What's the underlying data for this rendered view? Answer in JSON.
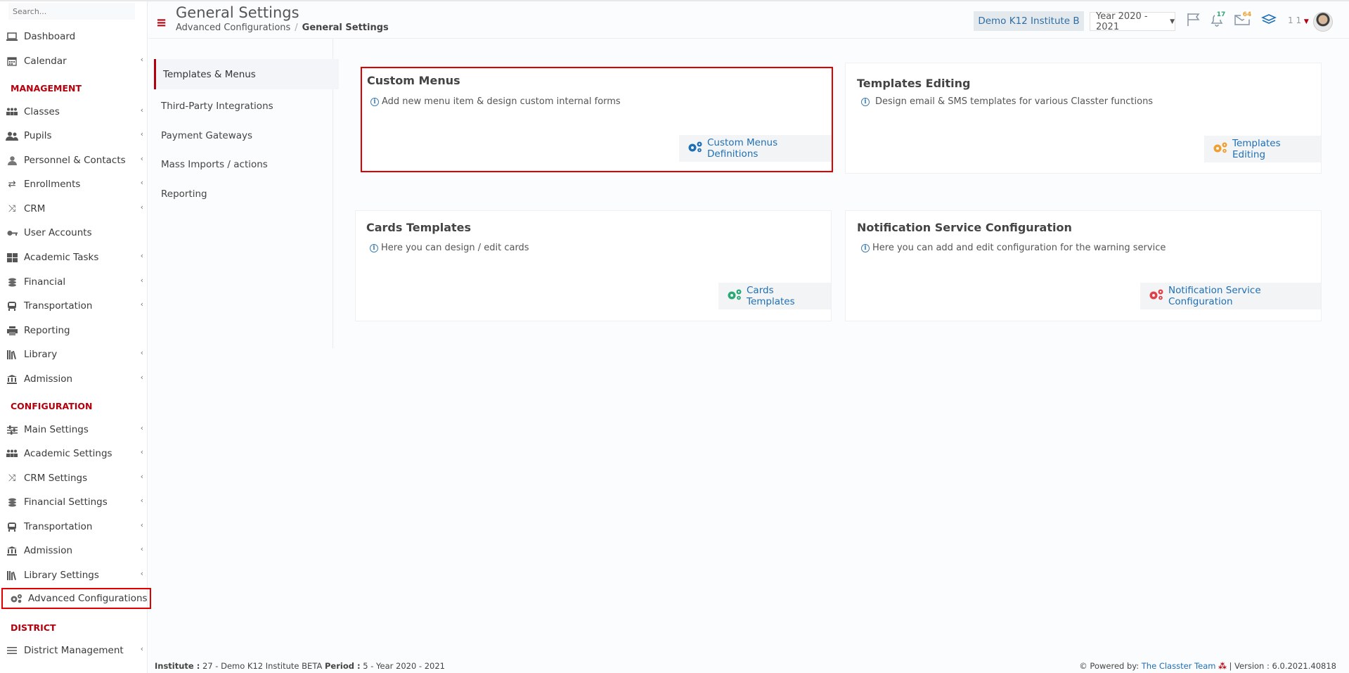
{
  "sidebar": {
    "search_placeholder": "Search...",
    "items_top": [
      {
        "label": "Dashboard"
      },
      {
        "label": "Calendar"
      }
    ],
    "sections": [
      {
        "title": "MANAGEMENT",
        "items": [
          {
            "label": "Classes"
          },
          {
            "label": "Pupils"
          },
          {
            "label": "Personnel & Contacts"
          },
          {
            "label": "Enrollments"
          },
          {
            "label": "CRM"
          },
          {
            "label": "User Accounts"
          },
          {
            "label": "Academic Tasks"
          },
          {
            "label": "Financial"
          },
          {
            "label": "Transportation"
          },
          {
            "label": "Reporting"
          },
          {
            "label": "Library"
          },
          {
            "label": "Admission"
          }
        ]
      },
      {
        "title": "CONFIGURATION",
        "items": [
          {
            "label": "Main Settings"
          },
          {
            "label": "Academic Settings"
          },
          {
            "label": "CRM Settings"
          },
          {
            "label": "Financial Settings"
          },
          {
            "label": "Transportation"
          },
          {
            "label": "Admission"
          },
          {
            "label": "Library Settings"
          },
          {
            "label": "Advanced Configurations"
          }
        ]
      },
      {
        "title": "DISTRICT",
        "items": [
          {
            "label": "District Management"
          }
        ]
      }
    ]
  },
  "header": {
    "title": "General Settings",
    "breadcrumb": [
      "Advanced Configurations",
      "/",
      "General Settings"
    ],
    "institute": "Demo K12 Institute B",
    "year": "Year 2020 - 2021",
    "notifications_count": "17",
    "messages_count": "64",
    "user_label": "1 1"
  },
  "settings_nav": {
    "active": "Templates & Menus",
    "items": [
      "Third-Party Integrations",
      "Payment Gateways",
      "Mass Imports / actions",
      "Reporting"
    ]
  },
  "cards": [
    {
      "title": "Custom Menus",
      "desc": "Add new menu item & design custom internal forms",
      "button": "Custom Menus Definitions",
      "icon_color": "#1f6fb5"
    },
    {
      "title": "Templates Editing",
      "desc": "Design email & SMS templates for various Classter functions",
      "button": "Templates Editing",
      "icon_color": "#f0a030"
    },
    {
      "title": "Cards Templates",
      "desc": "Here you can design / edit cards",
      "button": "Cards Templates",
      "icon_color": "#2aa876"
    },
    {
      "title": "Notification Service Configuration",
      "desc": "Here you can add and edit configuration for the warning service",
      "button": "Notification Service Configuration",
      "icon_color": "#e0404a"
    }
  ],
  "footer": {
    "institute_label": "Institute :",
    "institute_value": "27 - Demo K12 Institute BETA",
    "period_label": "Period :",
    "period_value": "5 - Year 2020 - 2021",
    "powered_by": "Powered by:",
    "powered_link": "The Classter Team",
    "version": "| Version : 6.0.2021.40818"
  }
}
